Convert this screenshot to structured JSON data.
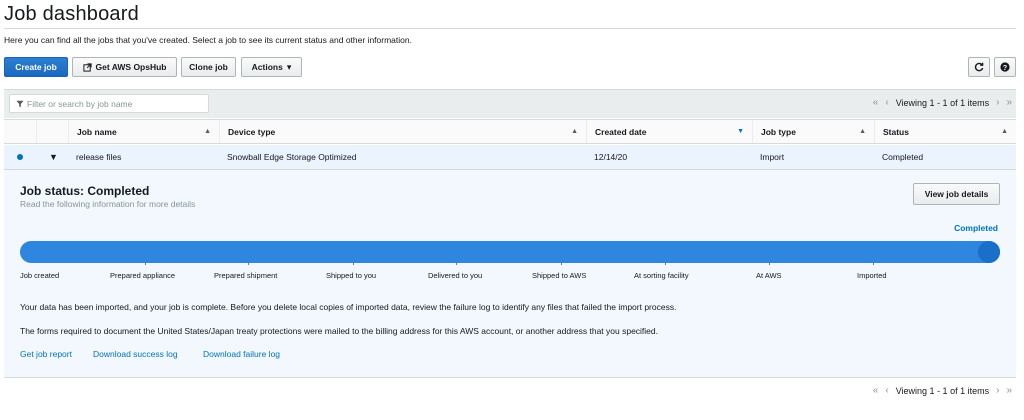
{
  "page": {
    "title": "Job dashboard",
    "description": "Here you can find all the jobs that you've created. Select a job to see its current status and other information."
  },
  "toolbar": {
    "create_job": "Create job",
    "get_opshub": "Get AWS OpsHub",
    "clone_job": "Clone job",
    "actions": "Actions",
    "actions_caret": "▾",
    "external_icon": "external-link-icon",
    "refresh_icon": "refresh-icon",
    "help_icon": "help-icon"
  },
  "filter": {
    "placeholder": "Filter or search by job name",
    "icon": "filter-icon"
  },
  "pagination": {
    "first": "«",
    "prev": "‹",
    "text": "Viewing 1 - 1 of 1 items",
    "next": "›",
    "last": "»"
  },
  "table": {
    "columns": [
      {
        "label": "Job name",
        "sort": "▲"
      },
      {
        "label": "Device type",
        "sort": "▲"
      },
      {
        "label": "Created date",
        "sort": "▼"
      },
      {
        "label": "Job type",
        "sort": "▲"
      },
      {
        "label": "Status",
        "sort": "▲"
      }
    ],
    "rows": [
      {
        "expand": "▼",
        "job_name": "release files",
        "device_type": "Snowball Edge Storage Optimized",
        "created_date": "12/14/20",
        "job_type": "Import",
        "status": "Completed"
      }
    ]
  },
  "detail": {
    "status_title": "Job status: Completed",
    "status_subtitle": "Read the following information for more details",
    "view_button": "View job details",
    "progress_label": "Completed",
    "progress_fraction": 1.0,
    "steps": [
      "Job created",
      "Prepared appliance",
      "Prepared shipment",
      "Shipped to you",
      "Delivered to you",
      "Shipped to AWS",
      "At sorting facility",
      "At AWS",
      "Imported"
    ],
    "message1": "Your data has been imported, and your job is complete. Before you delete local copies of imported data, review the failure log to identify any files that failed the import process.",
    "message2": "The forms required to document the United States/Japan treaty protections were mailed to the billing address for this AWS account, or another address that you specified.",
    "links": {
      "report": "Get job report",
      "success": "Download success log",
      "failure": "Download failure log"
    }
  },
  "colors": {
    "primary": "#1a69c1",
    "link": "#0073bb",
    "progress": "#2e86de",
    "selected_row": "#eaf3fe"
  }
}
